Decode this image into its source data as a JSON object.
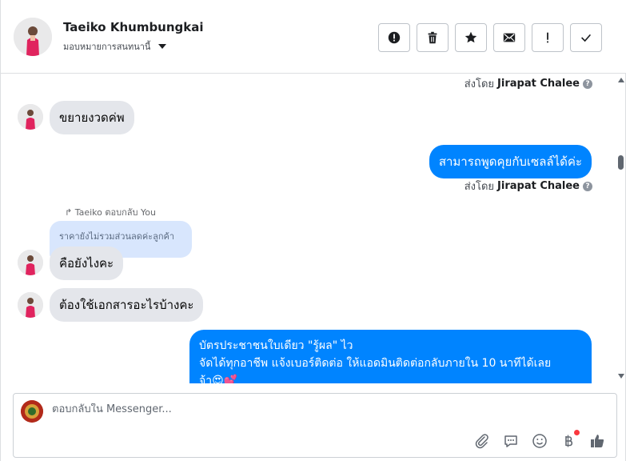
{
  "header": {
    "contact_name": "Taeiko Khumbungkai",
    "assign_label": "มอบหมายการสนทนานี้"
  },
  "actions": [
    {
      "name": "spam-button",
      "icon": "exclamation-circle-icon"
    },
    {
      "name": "delete-button",
      "icon": "trash-icon"
    },
    {
      "name": "star-button",
      "icon": "star-icon"
    },
    {
      "name": "mark-unread-button",
      "icon": "envelope-icon"
    },
    {
      "name": "follow-up-button",
      "icon": "exclamation-icon"
    },
    {
      "name": "done-button",
      "icon": "check-icon"
    }
  ],
  "messages": {
    "sent_by_prefix": "ส่งโดย",
    "sent_by_name": "Jirapat Chalee",
    "m1": "ขยายงวดค่พ",
    "m2": "สามารถพูดคุยกับเซลล์ได้ค่ะ",
    "reply_label": "Taeiko ตอบกลับ You",
    "quoted": "ราคายังไม่รวมส่วนลดค่ะลูกค้า",
    "m3": "คือยังไงคะ",
    "m4": "ต้องใช้เอกสารอะไรบ้างคะ",
    "m5_line1": "บัตรประชาชนใบเดียว \"รู้ผล\" ไว",
    "m5_line2": "จัดได้ทุกอาชีพ แจ้งเบอร์ติดต่อ ให้แอดมินติดต่อกลับภายใน 10 นาทีได้เลย",
    "m5_line3": "จ้า😍💕"
  },
  "composer": {
    "placeholder": "ตอบกลับใน Messenger...",
    "value": ""
  },
  "colors": {
    "outgoing_bubble": "#0084ff",
    "incoming_bubble": "#e4e6eb",
    "quoted_bubble": "#d8e6fd",
    "notification_dot": "#fa383e"
  }
}
